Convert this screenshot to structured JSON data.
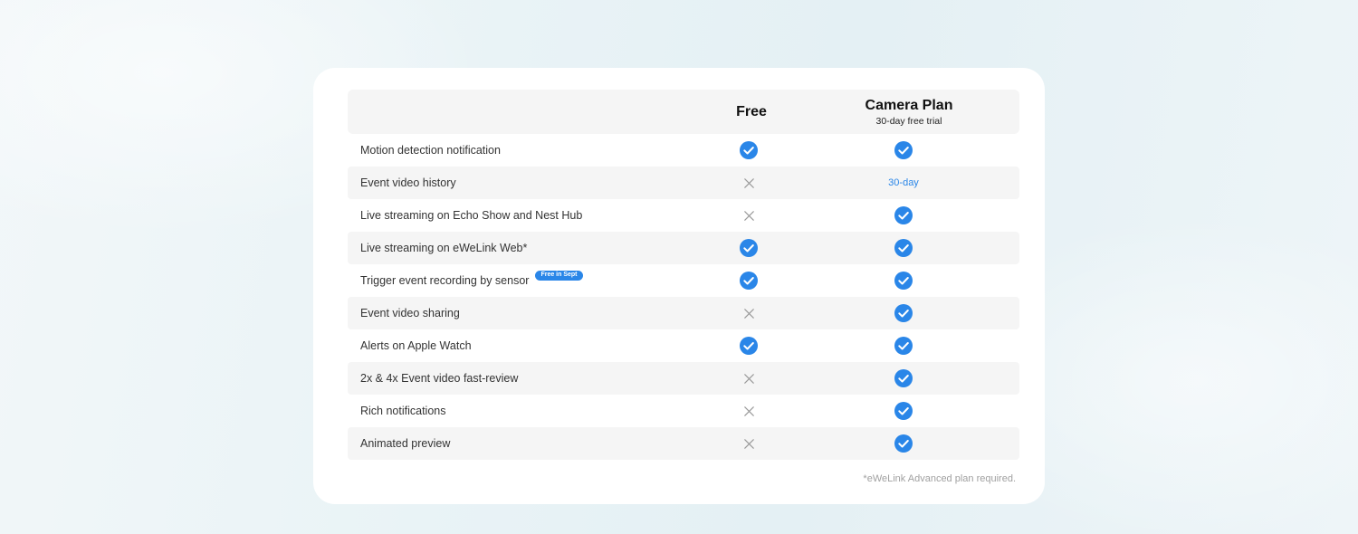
{
  "header": {
    "free_label": "Free",
    "plan_label": "Camera Plan",
    "plan_subtitle": "30-day free trial"
  },
  "rows": [
    {
      "feature": "Motion detection notification",
      "free": "check",
      "plan": "check"
    },
    {
      "feature": "Event video history",
      "free": "cross",
      "plan": "30-day"
    },
    {
      "feature": "Live streaming on Echo Show and Nest Hub",
      "free": "cross",
      "plan": "check"
    },
    {
      "feature": "Live streaming on eWeLink Web*",
      "free": "check",
      "plan": "check"
    },
    {
      "feature": "Trigger event recording by sensor",
      "badge": "Free in Sept",
      "free": "check",
      "plan": "check"
    },
    {
      "feature": "Event video sharing",
      "free": "cross",
      "plan": "check"
    },
    {
      "feature": "Alerts on Apple Watch",
      "free": "check",
      "plan": "check"
    },
    {
      "feature": "2x & 4x Event video fast-review",
      "free": "cross",
      "plan": "check"
    },
    {
      "feature": "Rich notifications",
      "free": "cross",
      "plan": "check"
    },
    {
      "feature": "Animated preview",
      "free": "cross",
      "plan": "check"
    }
  ],
  "footnote": "*eWeLink Advanced plan required.",
  "colors": {
    "accent": "#2a86e8",
    "cross": "#9a9a9a",
    "row_shade": "#f5f5f5"
  }
}
